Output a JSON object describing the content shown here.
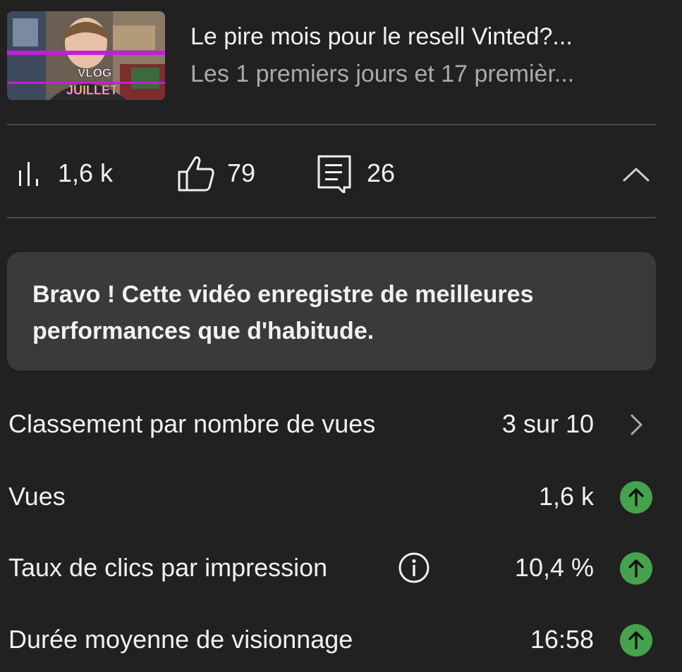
{
  "video": {
    "title": "Le pire mois pour le resell Vinted?...",
    "subtitle": "Les 1 premiers jours et 17 premièr...",
    "thumbnail_text_line1": "VLOG",
    "thumbnail_text_line2": "JUILLET",
    "thumbnail_icon": "video-thumbnail"
  },
  "stats": {
    "views": {
      "icon": "bar-chart-icon",
      "value": "1,6 k"
    },
    "likes": {
      "icon": "thumbs-up-icon",
      "value": "79"
    },
    "comments": {
      "icon": "comment-icon",
      "value": "26"
    },
    "collapse_icon": "chevron-up-icon"
  },
  "banner": {
    "text": "Bravo ! Cette vidéo enregistre de meilleures performances que d'habitude."
  },
  "metrics": [
    {
      "label": "Classement par nombre de vues",
      "value": "3 sur 10",
      "trail": "chevron-right-icon"
    },
    {
      "label": "Vues",
      "value": "1,6 k",
      "trail": "arrow-up-icon"
    },
    {
      "label": "Taux de clics par impression",
      "value": "10,4 %",
      "trail": "arrow-up-icon",
      "has_info": true
    },
    {
      "label": "Durée moyenne de visionnage",
      "value": "16:58",
      "trail": "arrow-up-icon"
    }
  ],
  "colors": {
    "background": "#212121",
    "banner": "#3a3a3a",
    "trend_up": "#45a34d",
    "text_primary": "#f1f1f1",
    "text_secondary": "#aaaaaa"
  }
}
